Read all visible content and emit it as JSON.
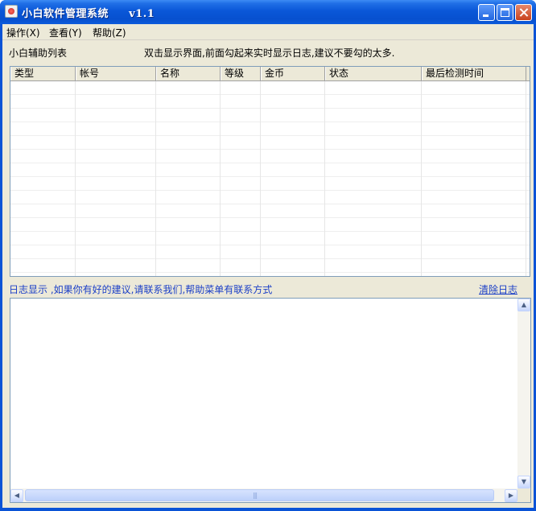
{
  "window": {
    "title": "小白软件管理系统     v1.1"
  },
  "menu": [
    {
      "label": "操作(X)"
    },
    {
      "label": "查看(Y)"
    },
    {
      "label": "帮助(Z)"
    }
  ],
  "list_section": {
    "title": "小白辅助列表",
    "hint": "双击显示界面,前面勾起来实时显示日志,建议不要勾的太多."
  },
  "table": {
    "columns": [
      "类型",
      "帐号",
      "名称",
      "等级",
      "金币",
      "状态",
      "最后检测时间"
    ],
    "rows": []
  },
  "log_section": {
    "label": "日志显示  ,如果你有好的建议,请联系我们,帮助菜单有联系方式",
    "clear_label": "清除日志",
    "content": ""
  },
  "colors": {
    "title_bar": "#0a57d8",
    "link": "#1b3fc7",
    "window_bg": "#ece9d8"
  }
}
